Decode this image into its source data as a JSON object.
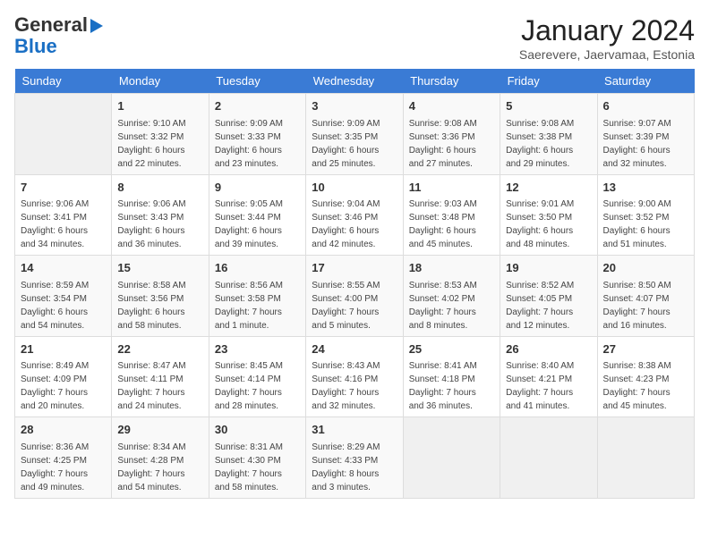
{
  "logo": {
    "line1": "General",
    "line2": "Blue"
  },
  "title": "January 2024",
  "subtitle": "Saerevere, Jaervamaa, Estonia",
  "days_of_week": [
    "Sunday",
    "Monday",
    "Tuesday",
    "Wednesday",
    "Thursday",
    "Friday",
    "Saturday"
  ],
  "weeks": [
    [
      {
        "day": "",
        "info": ""
      },
      {
        "day": "1",
        "info": "Sunrise: 9:10 AM\nSunset: 3:32 PM\nDaylight: 6 hours\nand 22 minutes."
      },
      {
        "day": "2",
        "info": "Sunrise: 9:09 AM\nSunset: 3:33 PM\nDaylight: 6 hours\nand 23 minutes."
      },
      {
        "day": "3",
        "info": "Sunrise: 9:09 AM\nSunset: 3:35 PM\nDaylight: 6 hours\nand 25 minutes."
      },
      {
        "day": "4",
        "info": "Sunrise: 9:08 AM\nSunset: 3:36 PM\nDaylight: 6 hours\nand 27 minutes."
      },
      {
        "day": "5",
        "info": "Sunrise: 9:08 AM\nSunset: 3:38 PM\nDaylight: 6 hours\nand 29 minutes."
      },
      {
        "day": "6",
        "info": "Sunrise: 9:07 AM\nSunset: 3:39 PM\nDaylight: 6 hours\nand 32 minutes."
      }
    ],
    [
      {
        "day": "7",
        "info": "Sunrise: 9:06 AM\nSunset: 3:41 PM\nDaylight: 6 hours\nand 34 minutes."
      },
      {
        "day": "8",
        "info": "Sunrise: 9:06 AM\nSunset: 3:43 PM\nDaylight: 6 hours\nand 36 minutes."
      },
      {
        "day": "9",
        "info": "Sunrise: 9:05 AM\nSunset: 3:44 PM\nDaylight: 6 hours\nand 39 minutes."
      },
      {
        "day": "10",
        "info": "Sunrise: 9:04 AM\nSunset: 3:46 PM\nDaylight: 6 hours\nand 42 minutes."
      },
      {
        "day": "11",
        "info": "Sunrise: 9:03 AM\nSunset: 3:48 PM\nDaylight: 6 hours\nand 45 minutes."
      },
      {
        "day": "12",
        "info": "Sunrise: 9:01 AM\nSunset: 3:50 PM\nDaylight: 6 hours\nand 48 minutes."
      },
      {
        "day": "13",
        "info": "Sunrise: 9:00 AM\nSunset: 3:52 PM\nDaylight: 6 hours\nand 51 minutes."
      }
    ],
    [
      {
        "day": "14",
        "info": "Sunrise: 8:59 AM\nSunset: 3:54 PM\nDaylight: 6 hours\nand 54 minutes."
      },
      {
        "day": "15",
        "info": "Sunrise: 8:58 AM\nSunset: 3:56 PM\nDaylight: 6 hours\nand 58 minutes."
      },
      {
        "day": "16",
        "info": "Sunrise: 8:56 AM\nSunset: 3:58 PM\nDaylight: 7 hours\nand 1 minute."
      },
      {
        "day": "17",
        "info": "Sunrise: 8:55 AM\nSunset: 4:00 PM\nDaylight: 7 hours\nand 5 minutes."
      },
      {
        "day": "18",
        "info": "Sunrise: 8:53 AM\nSunset: 4:02 PM\nDaylight: 7 hours\nand 8 minutes."
      },
      {
        "day": "19",
        "info": "Sunrise: 8:52 AM\nSunset: 4:05 PM\nDaylight: 7 hours\nand 12 minutes."
      },
      {
        "day": "20",
        "info": "Sunrise: 8:50 AM\nSunset: 4:07 PM\nDaylight: 7 hours\nand 16 minutes."
      }
    ],
    [
      {
        "day": "21",
        "info": "Sunrise: 8:49 AM\nSunset: 4:09 PM\nDaylight: 7 hours\nand 20 minutes."
      },
      {
        "day": "22",
        "info": "Sunrise: 8:47 AM\nSunset: 4:11 PM\nDaylight: 7 hours\nand 24 minutes."
      },
      {
        "day": "23",
        "info": "Sunrise: 8:45 AM\nSunset: 4:14 PM\nDaylight: 7 hours\nand 28 minutes."
      },
      {
        "day": "24",
        "info": "Sunrise: 8:43 AM\nSunset: 4:16 PM\nDaylight: 7 hours\nand 32 minutes."
      },
      {
        "day": "25",
        "info": "Sunrise: 8:41 AM\nSunset: 4:18 PM\nDaylight: 7 hours\nand 36 minutes."
      },
      {
        "day": "26",
        "info": "Sunrise: 8:40 AM\nSunset: 4:21 PM\nDaylight: 7 hours\nand 41 minutes."
      },
      {
        "day": "27",
        "info": "Sunrise: 8:38 AM\nSunset: 4:23 PM\nDaylight: 7 hours\nand 45 minutes."
      }
    ],
    [
      {
        "day": "28",
        "info": "Sunrise: 8:36 AM\nSunset: 4:25 PM\nDaylight: 7 hours\nand 49 minutes."
      },
      {
        "day": "29",
        "info": "Sunrise: 8:34 AM\nSunset: 4:28 PM\nDaylight: 7 hours\nand 54 minutes."
      },
      {
        "day": "30",
        "info": "Sunrise: 8:31 AM\nSunset: 4:30 PM\nDaylight: 7 hours\nand 58 minutes."
      },
      {
        "day": "31",
        "info": "Sunrise: 8:29 AM\nSunset: 4:33 PM\nDaylight: 8 hours\nand 3 minutes."
      },
      {
        "day": "",
        "info": ""
      },
      {
        "day": "",
        "info": ""
      },
      {
        "day": "",
        "info": ""
      }
    ]
  ]
}
